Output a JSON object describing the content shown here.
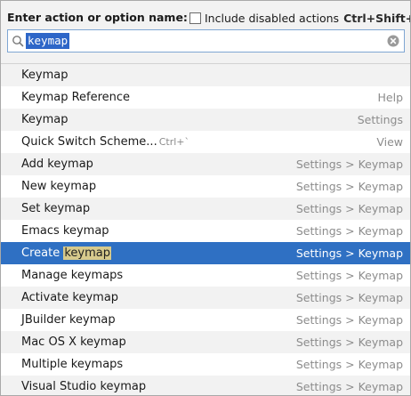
{
  "header": {
    "title": "Enter action or option name:",
    "include_disabled_label": "Include disabled actions",
    "include_disabled_checked": false,
    "shortcut": "Ctrl+Shift+A"
  },
  "search": {
    "value": "keymap",
    "search_icon": "search-icon",
    "clear_icon": "clear-icon"
  },
  "colors": {
    "selection": "#2f70c3",
    "match_highlight": "#d7ca8c",
    "location_text": "#8c8c8c"
  },
  "results": [
    {
      "label": "Keymap",
      "location": ""
    },
    {
      "label": "Keymap Reference",
      "location": "Help"
    },
    {
      "label": "Keymap",
      "location": "Settings"
    },
    {
      "label": "Quick Switch Scheme...",
      "hint": "Ctrl+`",
      "location": "View"
    },
    {
      "label": "Add keymap",
      "location": "Settings > Keymap"
    },
    {
      "label": "New keymap",
      "location": "Settings > Keymap"
    },
    {
      "label": "Set keymap",
      "location": "Settings > Keymap"
    },
    {
      "label": "Emacs keymap",
      "location": "Settings > Keymap"
    },
    {
      "label_prefix": "Create",
      "label_match": "keymap",
      "location": "Settings > Keymap",
      "selected": true
    },
    {
      "label": "Manage keymaps",
      "location": "Settings > Keymap"
    },
    {
      "label": "Activate keymap",
      "location": "Settings > Keymap"
    },
    {
      "label": "JBuilder keymap",
      "location": "Settings > Keymap"
    },
    {
      "label": "Mac OS X keymap",
      "location": "Settings > Keymap"
    },
    {
      "label": "Multiple keymaps",
      "location": "Settings > Keymap"
    },
    {
      "label": "Visual Studio keymap",
      "location": "Settings > Keymap"
    }
  ]
}
